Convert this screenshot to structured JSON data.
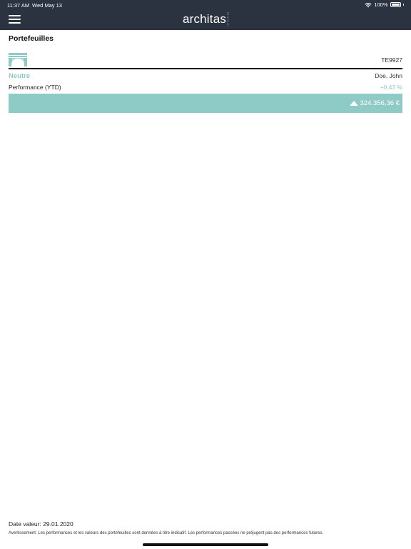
{
  "status_bar": {
    "time": "11:37 AM",
    "date": "Wed May 13",
    "battery": "100%"
  },
  "header": {
    "logo_text": "architas"
  },
  "page": {
    "title": "Portefeuilles"
  },
  "portfolio": {
    "code": "TE9927",
    "profile": "Neutre",
    "owner": "Doe, John",
    "performance_label": "Performance (YTD)",
    "performance_value": "+0,43 %",
    "value": "324.356,36 €",
    "trend": "up"
  },
  "footer": {
    "date_value": "Date valeur: 29.01.2020",
    "disclaimer": "Avertissement: Les performances et les valeurs des portefeuilles sont données à titre indicatif. Les performances passées ne préjugent pas des performances futures."
  },
  "colors": {
    "header_bg": "#2b3240",
    "accent": "#8ecac6"
  }
}
